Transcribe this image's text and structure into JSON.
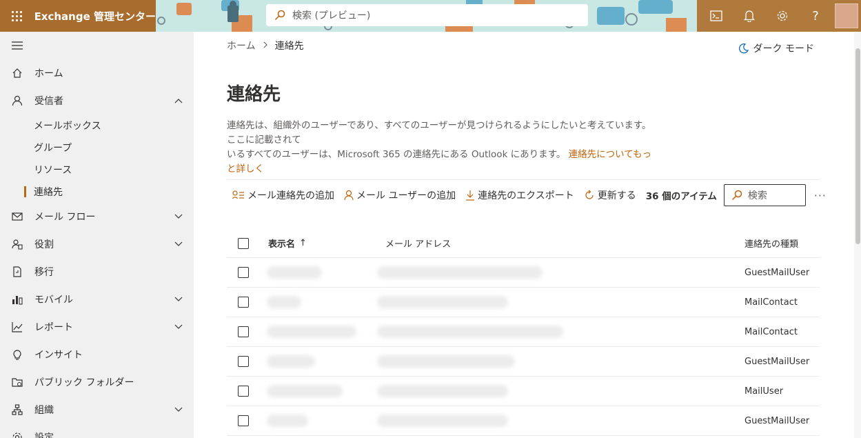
{
  "header": {
    "app_title": "Exchange 管理センター",
    "search_placeholder": "検索 (プレビュー)",
    "brand_color": "#a86d2e"
  },
  "sidebar": {
    "items": [
      {
        "label": "ホーム",
        "icon": "home-icon"
      },
      {
        "label": "受信者",
        "icon": "person-icon",
        "expanded": true
      },
      {
        "label": "メール フロー",
        "icon": "mail-icon"
      },
      {
        "label": "役割",
        "icon": "role-icon"
      },
      {
        "label": "移行",
        "icon": "migrate-icon"
      },
      {
        "label": "モバイル",
        "icon": "mobile-icon"
      },
      {
        "label": "レポート",
        "icon": "chart-icon"
      },
      {
        "label": "インサイト",
        "icon": "lightbulb-icon"
      },
      {
        "label": "パブリック フォルダー",
        "icon": "folder-icon"
      },
      {
        "label": "組織",
        "icon": "org-icon"
      },
      {
        "label": "設定",
        "icon": "settings-icon"
      }
    ],
    "sub_items": [
      "メールボックス",
      "グループ",
      "リソース",
      "連絡先"
    ],
    "active_sub_item": "連絡先",
    "accent": "#b36a16"
  },
  "main": {
    "breadcrumb": {
      "home": "ホーム",
      "current": "連絡先"
    },
    "dark_mode_label": "ダーク モード",
    "title": "連絡先",
    "description_line1": "連絡先は、組織外のユーザーであり、すべてのユーザーが見つけられるようにしたいと考えています。ここに記載されて",
    "description_line2": "いるすべてのユーザーは、Microsoft 365 の連絡先にある Outlook にあります。",
    "description_link": "連絡先についてもっと詳しく",
    "commands": {
      "add_mail_contact": "メール連絡先の追加",
      "add_mail_user": "メール ユーザーの追加",
      "export_contacts": "連絡先のエクスポート",
      "refresh": "更新する"
    },
    "item_count": "36 個のアイテム",
    "list_search_placeholder": "検索",
    "table": {
      "headers": {
        "display_name": "表示名",
        "email": "メール アドレス",
        "contact_type": "連絡先の種類"
      },
      "sort_indicator": "↑",
      "rows": [
        {
          "contact_type": "GuestMailUser"
        },
        {
          "contact_type": "MailContact"
        },
        {
          "contact_type": "MailContact"
        },
        {
          "contact_type": "GuestMailUser"
        },
        {
          "contact_type": "MailUser"
        },
        {
          "contact_type": "GuestMailUser"
        }
      ]
    }
  }
}
